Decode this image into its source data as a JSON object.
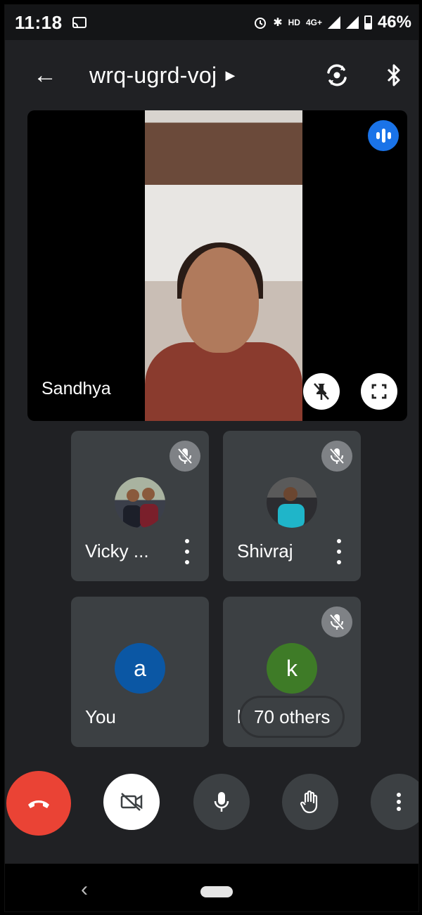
{
  "status_bar": {
    "time": "11:18",
    "alarm_icon": "alarm-icon",
    "bluetooth_icon": "bluetooth-icon",
    "hd_label": "HD",
    "network_label": "4G+",
    "battery_percent": "46%"
  },
  "top_bar": {
    "meeting_code": "wrq-ugrd-voj"
  },
  "main_tile": {
    "participant_name": "Sandhya",
    "speaking": true
  },
  "participants": [
    {
      "name": "Vicky ...",
      "muted": true,
      "avatar_type": "photo"
    },
    {
      "name": "Shivraj",
      "muted": true,
      "avatar_type": "photo"
    },
    {
      "name": "You",
      "initial": "a",
      "muted": false,
      "avatar_color": "#0b57a4"
    },
    {
      "name": "krutika",
      "initial": "k",
      "muted": true,
      "avatar_color": "#3e7b27"
    }
  ],
  "others_chip": "70 others",
  "colors": {
    "end_call": "#ea4335",
    "speaking_badge": "#1a73e8",
    "tile_bg": "#3c4043",
    "app_bg": "#202124"
  }
}
